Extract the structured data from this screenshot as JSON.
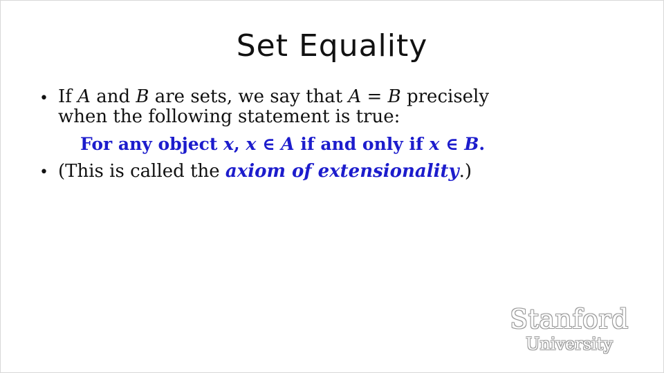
{
  "slide": {
    "title": "Set Equality",
    "bullets": [
      {
        "line1": {
          "p1": "If ",
          "m1": "A",
          "p2": " and ",
          "m2": "B",
          "p3": " are sets, we say that ",
          "m3": "A",
          "p4": " = ",
          "m4": "B",
          "p5": " precisely"
        },
        "line2": "when the following statement is true:"
      },
      {
        "p1": "(This is called the ",
        "term": "axiom of extensionality",
        "p2": ".)"
      }
    ],
    "definition": {
      "p1": "For any object ",
      "m1": "x",
      "p2": ", ",
      "m2": "x",
      "p3": " ∈ ",
      "m3": "A",
      "p4": " if and only if ",
      "m4": "x",
      "p5": " ∈ ",
      "m5": "B",
      "p6": "."
    },
    "bullet_glyph": "•"
  },
  "logo": {
    "name": "Stanford",
    "sub": "University"
  },
  "colors": {
    "accent": "#1c1ccc",
    "text": "#111111",
    "background": "#ffffff"
  }
}
